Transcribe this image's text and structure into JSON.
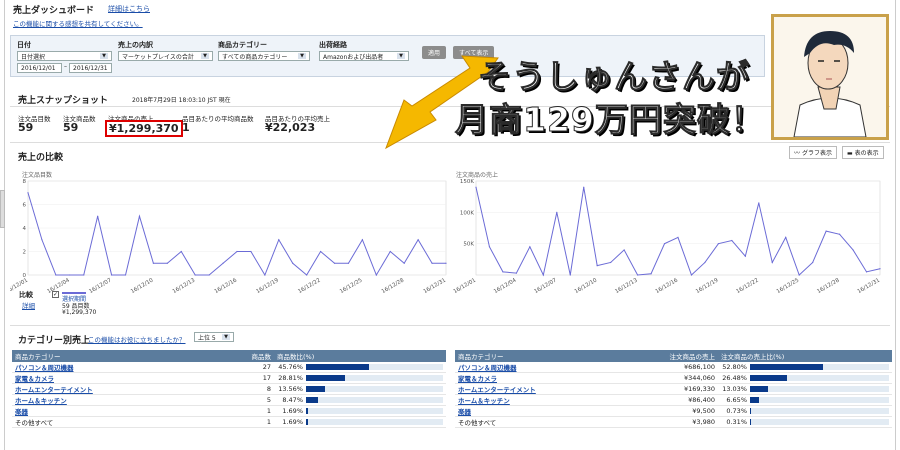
{
  "header": {
    "title": "売上ダッシュボード",
    "details_link": "詳細はこちら",
    "feedback_link": "この機能に関する感想を共有してください。"
  },
  "filters": {
    "date": {
      "label": "日付",
      "preset": "日付選択",
      "from": "2016/12/01",
      "to": "2016/12/31"
    },
    "sales_breakdown": {
      "label": "売上の内訳",
      "value": "マーケットプレイスの合計"
    },
    "category": {
      "label": "商品カテゴリー",
      "value": "すべての商品カテゴリー"
    },
    "channel": {
      "label": "出荷経路",
      "value": "Amazonおよび出品者"
    },
    "apply": "適用",
    "show_all": "すべて表示"
  },
  "banner": {
    "line1": "そうしゅんさんが",
    "line2": "月商129万円突破！"
  },
  "snapshot": {
    "title": "売上スナップショット",
    "timestamp": "2018年7月29日 18:03:10 JST 現在",
    "metrics": [
      {
        "label": "注文品目数",
        "value": "59"
      },
      {
        "label": "注文商品数",
        "value": "59"
      },
      {
        "label": "注文商品の売上",
        "value": "¥1,299,370"
      },
      {
        "label": "品目あたりの平均商品数",
        "value": "1"
      },
      {
        "label": "品目あたりの平均売上",
        "value": "¥22,023"
      }
    ]
  },
  "comparison": {
    "title": "売上の比較",
    "graph_view": "グラフ表示",
    "table_view": "表の表示",
    "compare_label": "比較",
    "detail_link": "詳細",
    "legend": {
      "name": "選択期間",
      "line2": "59 品目数",
      "line3": "¥1,299,370"
    }
  },
  "chart_data": [
    {
      "type": "line",
      "title": "注文品目数",
      "ylim": [
        0,
        8
      ],
      "yticks": [
        "0",
        "2",
        "4",
        "6",
        "8"
      ],
      "xticks": [
        "16/12/01",
        "16/12/04",
        "16/12/07",
        "16/12/10",
        "16/12/13",
        "16/12/16",
        "16/12/19",
        "16/12/22",
        "16/12/25",
        "16/12/28",
        "16/12/31"
      ],
      "values": [
        7,
        3,
        0,
        0,
        0,
        5,
        0,
        0,
        5,
        1,
        1,
        2,
        0,
        0,
        1,
        2,
        2,
        0,
        3,
        1,
        0,
        2,
        1,
        1,
        3,
        0,
        2,
        1,
        3,
        1,
        1
      ]
    },
    {
      "type": "line",
      "title": "注文商品の売上",
      "ylim": [
        0,
        150000
      ],
      "yticks": [
        "50K",
        "100K",
        "150K"
      ],
      "xticks": [
        "16/12/01",
        "16/12/04",
        "16/12/07",
        "16/12/10",
        "16/12/13",
        "16/12/16",
        "16/12/19",
        "16/12/22",
        "16/12/25",
        "16/12/28",
        "16/12/31"
      ],
      "values": [
        140000,
        45000,
        5000,
        3000,
        45000,
        0,
        100000,
        0,
        140000,
        15000,
        20000,
        40000,
        0,
        2000,
        50000,
        60000,
        0,
        20000,
        50000,
        55000,
        30000,
        115000,
        20000,
        60000,
        0,
        20000,
        70000,
        65000,
        40000,
        5000,
        10000
      ]
    }
  ],
  "category": {
    "title": "カテゴリー別売上",
    "help_link": "この機能はお役に立ちましたか？",
    "top_select": "上位 5",
    "left": {
      "headers": [
        "商品カテゴリー",
        "商品数",
        "商品数比(%)"
      ],
      "rows": [
        {
          "name": "パソコン＆周辺機器",
          "count": "27",
          "pct": "45.76%",
          "share": 45.76,
          "link": true
        },
        {
          "name": "家電＆カメラ",
          "count": "17",
          "pct": "28.81%",
          "share": 28.81,
          "link": true
        },
        {
          "name": "ホームエンターテイメント",
          "count": "8",
          "pct": "13.56%",
          "share": 13.56,
          "link": true
        },
        {
          "name": "ホーム＆キッチン",
          "count": "5",
          "pct": "8.47%",
          "share": 8.47,
          "link": true
        },
        {
          "name": "楽器",
          "count": "1",
          "pct": "1.69%",
          "share": 1.69,
          "link": true
        },
        {
          "name": "その他すべて",
          "count": "1",
          "pct": "1.69%",
          "share": 1.69,
          "link": false
        }
      ]
    },
    "right": {
      "headers": [
        "商品カテゴリー",
        "注文商品の売上",
        "注文商品の売上比(%)"
      ],
      "rows": [
        {
          "name": "パソコン＆周辺機器",
          "count": "¥686,100",
          "pct": "52.80%",
          "share": 52.8,
          "link": true
        },
        {
          "name": "家電＆カメラ",
          "count": "¥344,060",
          "pct": "26.48%",
          "share": 26.48,
          "link": true
        },
        {
          "name": "ホームエンターテイメント",
          "count": "¥169,330",
          "pct": "13.03%",
          "share": 13.03,
          "link": true
        },
        {
          "name": "ホーム＆キッチン",
          "count": "¥86,400",
          "pct": "6.65%",
          "share": 6.65,
          "link": true
        },
        {
          "name": "楽器",
          "count": "¥9,500",
          "pct": "0.73%",
          "share": 0.73,
          "link": true
        },
        {
          "name": "その他すべて",
          "count": "¥3,980",
          "pct": "0.31%",
          "share": 0.31,
          "link": false
        }
      ]
    }
  },
  "colors": {
    "line": "#6b6bd6",
    "bar": "#0a3a8a",
    "header": "#5b7c9d",
    "accent_red": "#dd0000",
    "banner_yellow": "#f5b800"
  }
}
